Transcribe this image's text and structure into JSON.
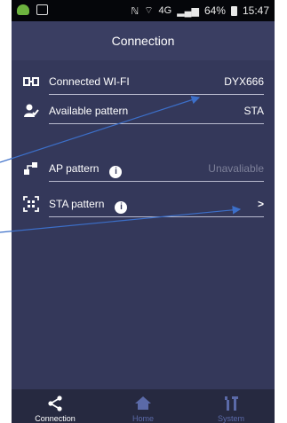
{
  "status_bar": {
    "network": "4G",
    "battery": "64%",
    "time": "15:47"
  },
  "header": {
    "title": "Connection"
  },
  "rows": [
    {
      "label": "Connected WI-FI",
      "value": "DYX666",
      "icon": "wifi-link-icon"
    },
    {
      "label": "Available pattern",
      "value": "STA",
      "icon": "user-check-icon"
    },
    {
      "label": "AP pattern",
      "value": "Unavaliable",
      "icon": "ap-icon"
    },
    {
      "label": "STA pattern",
      "value": ">",
      "icon": "qr-scan-icon"
    }
  ],
  "tabs": [
    {
      "label": "Connection",
      "icon": "share-icon",
      "active": true
    },
    {
      "label": "Home",
      "icon": "home-icon",
      "active": false
    },
    {
      "label": "System",
      "icon": "tools-icon",
      "active": false
    }
  ],
  "colors": {
    "background": "#34385a",
    "title_bar": "#3a3e62",
    "tab_bar": "#262940",
    "annotation_arrow": "#3c6fc9",
    "muted_text": "#7d8099"
  }
}
